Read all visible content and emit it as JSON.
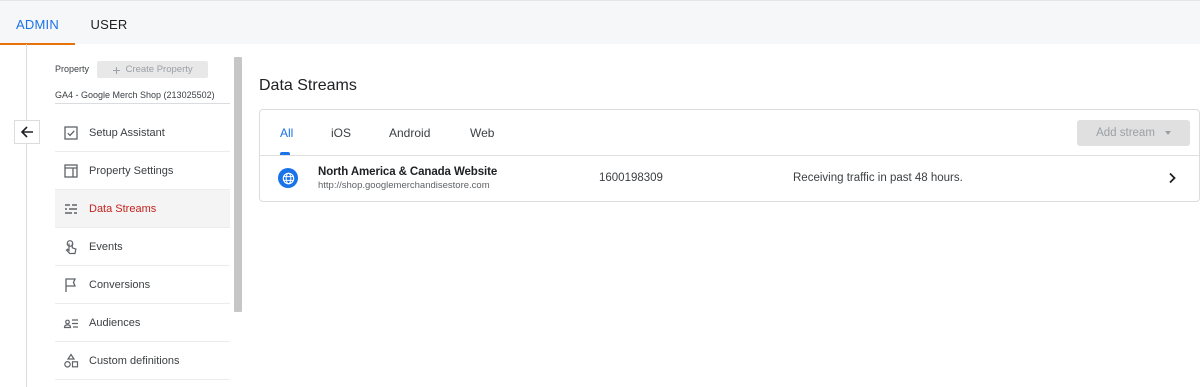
{
  "top_tabs": {
    "admin": "ADMIN",
    "user": "USER"
  },
  "sidebar": {
    "property_label": "Property",
    "create_property": "Create Property",
    "property_name": "GA4 - Google Merch Shop (213025502)",
    "items": [
      {
        "label": "Setup Assistant",
        "icon": "checkbox-icon"
      },
      {
        "label": "Property Settings",
        "icon": "layout-icon"
      },
      {
        "label": "Data Streams",
        "icon": "data-streams-icon",
        "active": true
      },
      {
        "label": "Events",
        "icon": "touch-icon"
      },
      {
        "label": "Conversions",
        "icon": "flag-icon"
      },
      {
        "label": "Audiences",
        "icon": "audience-icon"
      },
      {
        "label": "Custom definitions",
        "icon": "shapes-icon"
      }
    ]
  },
  "main": {
    "title": "Data Streams",
    "tabs": [
      "All",
      "iOS",
      "Android",
      "Web"
    ],
    "add_stream": "Add stream",
    "stream": {
      "name": "North America & Canada Website",
      "url": "http://shop.googlemerchandisestore.com",
      "id": "1600198309",
      "status": "Receiving traffic in past 48 hours."
    }
  },
  "colors": {
    "accent": "#1a73e8",
    "active_item": "#c5221f",
    "tab_indicator": "#e8710a"
  }
}
